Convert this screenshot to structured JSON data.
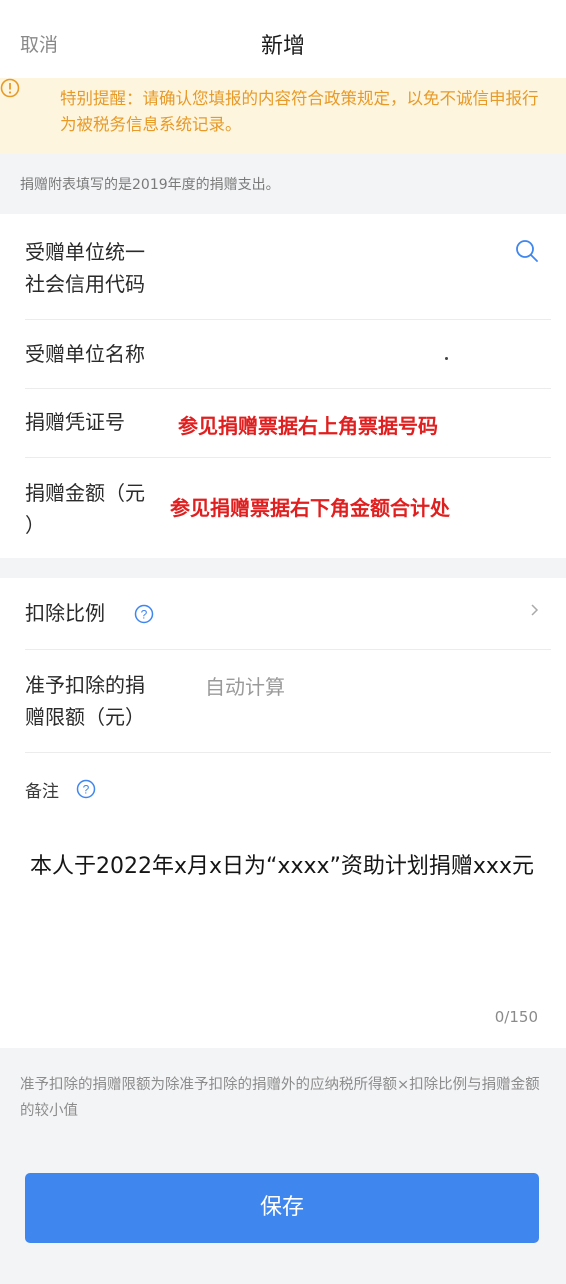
{
  "header": {
    "cancel_label": "取消",
    "title": "新增"
  },
  "warning": {
    "icon": "warning-circle-icon",
    "text": "特别提醒：请确认您填报的内容符合政策规定，以免不诚信申报行为被税务信息系统记录。"
  },
  "notice": "捐赠附表填写的是2019年度的捐赠支出。",
  "form1": {
    "recipient_code_label_line1": "受赠单位统一",
    "recipient_code_label_line2": "社会信用代码",
    "recipient_name_label": "受赠单位名称",
    "voucher_no_label": "捐赠凭证号",
    "voucher_no_hint": "参见捐赠票据右上角票据号码",
    "amount_label_line1": "捐赠金额（元",
    "amount_label_line2": "）",
    "amount_hint": "参见捐赠票据右下角金额合计处"
  },
  "form2": {
    "ratio_label": "扣除比例",
    "limit_label_line1": "准予扣除的捐",
    "limit_label_line2": "赠限额（元）",
    "limit_value": "自动计算",
    "remark_label": "备注",
    "remark_text": "本人于2022年x月x日为“xxxx”资助计划捐赠xxx元",
    "counter": "0/150"
  },
  "footnote": "准予扣除的捐赠限额为除准予扣除的捐赠外的应纳税所得额×扣除比例与捐赠金额的较小值",
  "save_label": "保存",
  "colors": {
    "accent": "#3f86ef",
    "warning": "#e79a28",
    "warning_bg": "#fdf5de",
    "hint_red": "#e02020"
  }
}
